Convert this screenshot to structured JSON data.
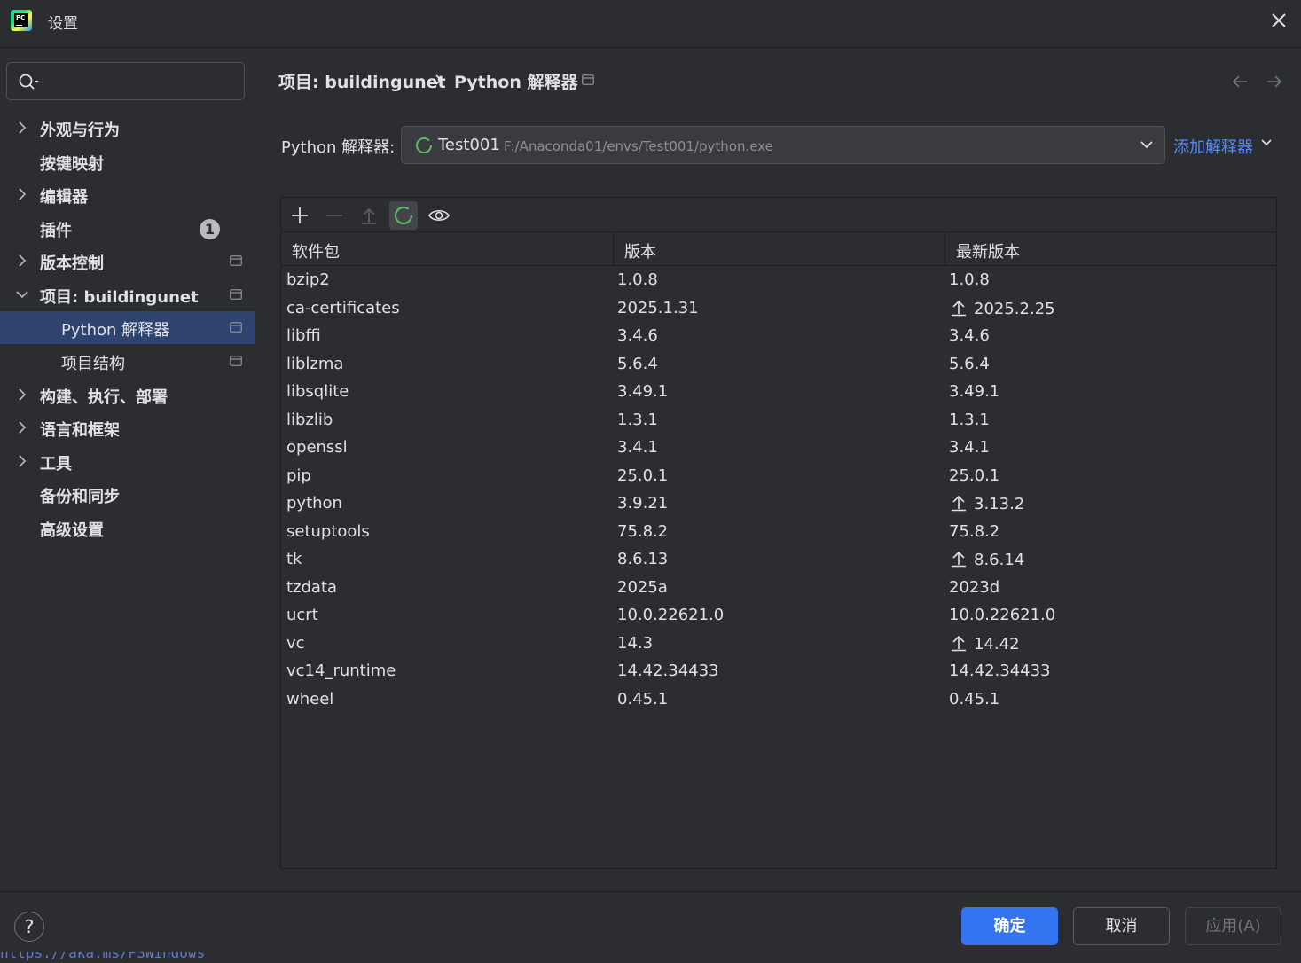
{
  "window": {
    "title": "设置"
  },
  "sidebar": {
    "items": [
      {
        "label": "外观与行为",
        "expandable": true
      },
      {
        "label": "按键映射"
      },
      {
        "label": "编辑器",
        "expandable": true
      },
      {
        "label": "插件",
        "badge": "1"
      },
      {
        "label": "版本控制",
        "expandable": true
      },
      {
        "label": "项目: buildingunet",
        "expanded": true
      },
      {
        "label": "Python 解释器",
        "selected": true
      },
      {
        "label": "项目结构"
      },
      {
        "label": "构建、执行、部署",
        "expandable": true
      },
      {
        "label": "语言和框架",
        "expandable": true
      },
      {
        "label": "工具",
        "expandable": true
      },
      {
        "label": "备份和同步"
      },
      {
        "label": "高级设置"
      }
    ]
  },
  "breadcrumb": {
    "project": "项目: buildingunet",
    "page": "Python 解释器"
  },
  "interpreter": {
    "label": "Python 解释器:",
    "name": "Test001",
    "path": "F:/Anaconda01/envs/Test001/python.exe",
    "add_label": "添加解释器"
  },
  "table": {
    "headers": [
      "软件包",
      "版本",
      "最新版本"
    ],
    "rows": [
      {
        "name": "bzip2",
        "version": "1.0.8",
        "latest": "1.0.8",
        "upgrade": false
      },
      {
        "name": "ca-certificates",
        "version": "2025.1.31",
        "latest": "2025.2.25",
        "upgrade": true
      },
      {
        "name": "libffi",
        "version": "3.4.6",
        "latest": "3.4.6",
        "upgrade": false
      },
      {
        "name": "liblzma",
        "version": "5.6.4",
        "latest": "5.6.4",
        "upgrade": false
      },
      {
        "name": "libsqlite",
        "version": "3.49.1",
        "latest": "3.49.1",
        "upgrade": false
      },
      {
        "name": "libzlib",
        "version": "1.3.1",
        "latest": "1.3.1",
        "upgrade": false
      },
      {
        "name": "openssl",
        "version": "3.4.1",
        "latest": "3.4.1",
        "upgrade": false
      },
      {
        "name": "pip",
        "version": "25.0.1",
        "latest": "25.0.1",
        "upgrade": false
      },
      {
        "name": "python",
        "version": "3.9.21",
        "latest": "3.13.2",
        "upgrade": true
      },
      {
        "name": "setuptools",
        "version": "75.8.2",
        "latest": "75.8.2",
        "upgrade": false
      },
      {
        "name": "tk",
        "version": "8.6.13",
        "latest": "8.6.14",
        "upgrade": true
      },
      {
        "name": "tzdata",
        "version": "2025a",
        "latest": "2023d",
        "upgrade": false
      },
      {
        "name": "ucrt",
        "version": "10.0.22621.0",
        "latest": "10.0.22621.0",
        "upgrade": false
      },
      {
        "name": "vc",
        "version": "14.3",
        "latest": "14.42",
        "upgrade": true
      },
      {
        "name": "vc14_runtime",
        "version": "14.42.34433",
        "latest": "14.42.34433",
        "upgrade": false
      },
      {
        "name": "wheel",
        "version": "0.45.1",
        "latest": "0.45.1",
        "upgrade": false
      }
    ]
  },
  "footer": {
    "help": "?",
    "ok": "确定",
    "cancel": "取消",
    "apply": "应用(A)",
    "background_text": "https://aka.ms/PSWindows"
  },
  "colors": {
    "background": "#2b2d30",
    "selection": "#2e436e",
    "accent": "#3574f0",
    "link": "#548af7",
    "spinner": "#5fb865"
  },
  "icons": {
    "toolbar": [
      "plus-icon",
      "minus-icon",
      "upgrade-icon",
      "refresh-spinner-icon",
      "eye-icon"
    ]
  }
}
